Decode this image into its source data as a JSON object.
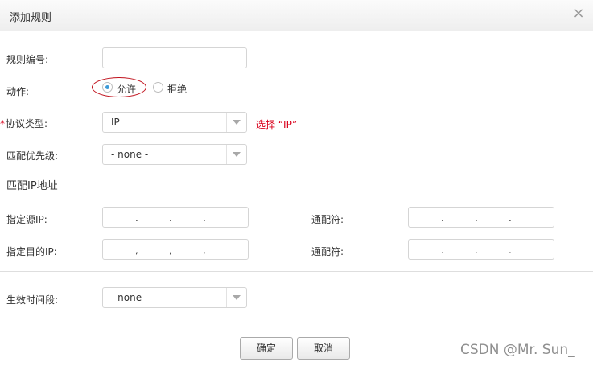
{
  "dialog": {
    "title": "添加规则",
    "close_symbol": "×"
  },
  "form": {
    "rule_number_label": "规则编号:",
    "rule_number_value": "",
    "action_label": "动作:",
    "action_options": [
      {
        "label": "允许",
        "selected": true
      },
      {
        "label": "拒绝",
        "selected": false
      }
    ],
    "protocol_label": "协议类型:",
    "protocol_required": "*",
    "protocol_value": "IP",
    "protocol_hint": "选择 “IP”",
    "priority_label": "匹配优先级:",
    "priority_value": "- none -",
    "section_title": "匹配IP地址",
    "source_ip_label": "指定源IP:",
    "dest_ip_label": "指定目的IP:",
    "wildcard_label": "通配符:",
    "ip_separator": ".",
    "dest_separator": ",",
    "schedule_label": "生效时间段:",
    "schedule_value": "- none -"
  },
  "buttons": {
    "ok": "确定",
    "cancel": "取消"
  },
  "watermark": "CSDN @Mr. Sun_",
  "colors": {
    "accent": "#3d9ad8",
    "hint": "#d9001b",
    "annotation": "#c0101b"
  }
}
